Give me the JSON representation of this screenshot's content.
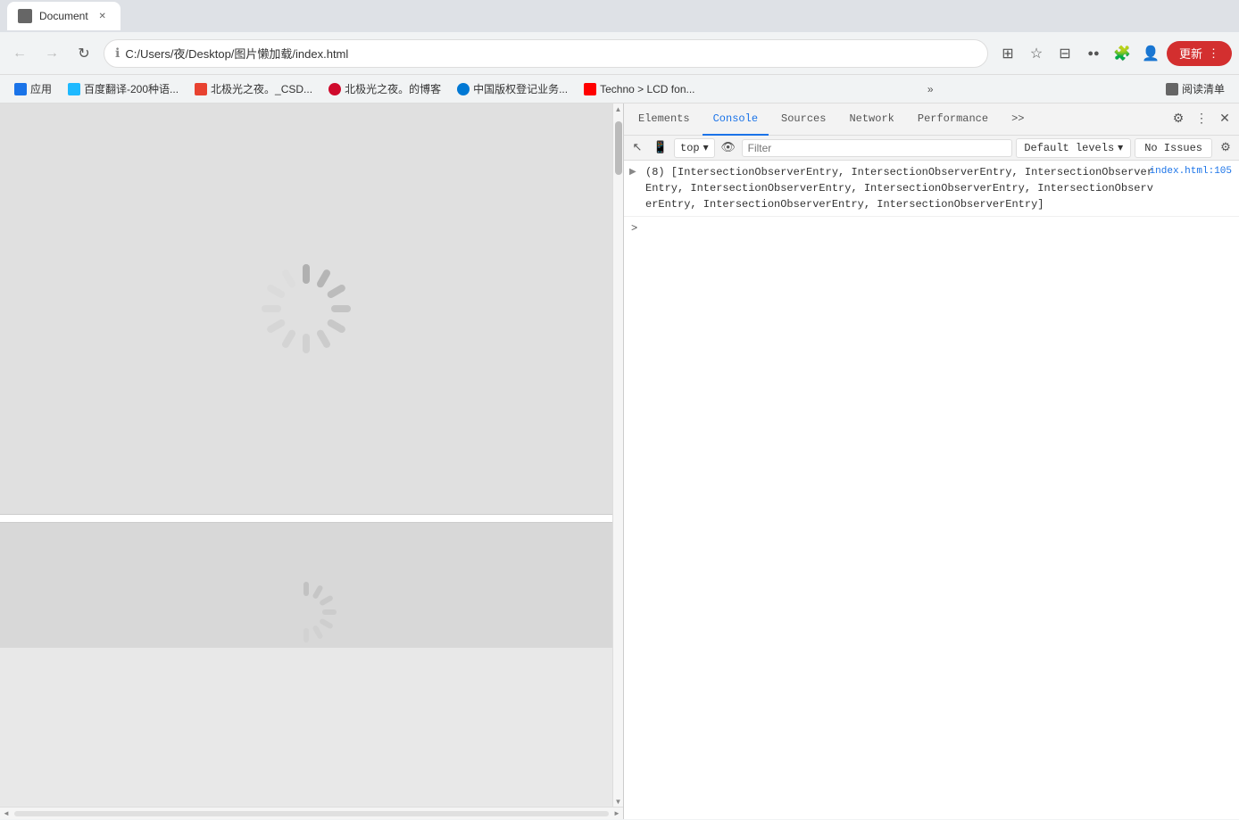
{
  "browser": {
    "tab": {
      "title": "Document",
      "favicon": "D"
    },
    "address": {
      "url": "C:/Users/夜/Desktop/图片懒加载/index.html",
      "info_icon": "ℹ"
    },
    "nav": {
      "back": "←",
      "forward": "→",
      "refresh": "↻"
    },
    "update_btn_label": "更新",
    "more_btn": "⋮"
  },
  "bookmarks": [
    {
      "id": "apps",
      "label": "应用",
      "color": "fav-apps"
    },
    {
      "id": "baidu",
      "label": "百度翻译-200种语...",
      "color": "fav-baidu"
    },
    {
      "id": "csd",
      "label": "北极光之夜。_CSD...",
      "color": "fav-csd"
    },
    {
      "id": "huawei",
      "label": "北极光之夜。的博客",
      "color": "fav-huawei"
    },
    {
      "id": "csdn",
      "label": "中国版权登记业务...",
      "color": "fav-copyright"
    },
    {
      "id": "techno",
      "label": "Techno > LCD fon...",
      "color": "fav-techno"
    },
    {
      "id": "more",
      "label": "»"
    },
    {
      "id": "readlist",
      "label": "阅读清单",
      "color": "fav-readlist"
    }
  ],
  "devtools": {
    "tabs": [
      {
        "id": "elements",
        "label": "Elements"
      },
      {
        "id": "console",
        "label": "Console",
        "active": true
      },
      {
        "id": "sources",
        "label": "Sources"
      },
      {
        "id": "network",
        "label": "Network"
      },
      {
        "id": "performance",
        "label": "Performance"
      },
      {
        "id": "more",
        "label": ">>"
      }
    ],
    "toolbar": {
      "top_selector": "top",
      "filter_placeholder": "Filter",
      "default_levels": "Default levels",
      "no_issues": "No Issues"
    },
    "console_entries": [
      {
        "source": "index.html:105",
        "has_expand": false,
        "text": "(8) [IntersectionObserverEntry, IntersectionObserverEntry, IntersectionObserverEntry, IntersectionObserverEntry, IntersectionObserverEntry, IntersectionObserverEntry, IntersectionObserverEntry, IntersectionObserverEntry]",
        "short_text": "(8) [IntersectionObserverEntry, IntersectionObserverEntry, IntersectionObserver\nEntry, IntersectionObserverEntry, IntersectionObserverEntry, IntersectionObserv\nerEntry, IntersectionObserverEntry, IntersectionObserverEntry]",
        "expandable": true
      }
    ],
    "prompt_chevron": ">"
  },
  "icons": {
    "gear": "⚙",
    "close": "✕",
    "three_dots": "⋮",
    "chevron_down": "▾",
    "chevron_right": "▶",
    "expand_right": "▶",
    "eye": "👁",
    "ban": "🚫",
    "cursor": "↖",
    "device": "📱",
    "star": "★",
    "translate": "🌐",
    "extension": "🧩",
    "profile": "👤",
    "left_panel": "⬜"
  },
  "page": {
    "bg_color": "#e0e0e0",
    "white_gap_color": "#ffffff"
  }
}
